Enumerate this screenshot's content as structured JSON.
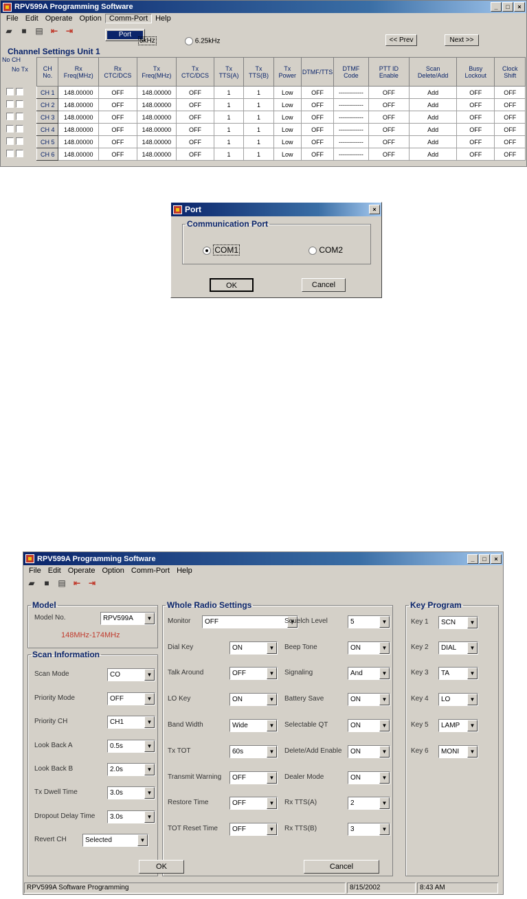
{
  "top_window": {
    "title": "RPV599A Programming Software",
    "menu": [
      "File",
      "Edit",
      "Operate",
      "Option",
      "Comm-Port",
      "Help"
    ],
    "menu_popup": "Port",
    "step_partial": "5kHz",
    "step_625": "6.25kHz",
    "prev_label": "<< Prev",
    "next_label": "Next >>",
    "group_title": "Channel Settings Unit 1",
    "nocol_label": "No CH",
    "notx_label": "No Tx",
    "headers": [
      "CH No.",
      "Rx Freq(MHz)",
      "Rx CTC/DCS",
      "Tx Freq(MHz)",
      "Tx CTC/DCS",
      "Tx TTS(A)",
      "Tx TTS(B)",
      "Tx Power",
      "DTMF/TTS",
      "DTMF Code",
      "PTT ID Enable",
      "Scan Delete/Add",
      "Busy Lockout",
      "Clock Shift"
    ],
    "rows": [
      [
        "CH 1",
        "148.00000",
        "OFF",
        "148.00000",
        "OFF",
        "1",
        "1",
        "Low",
        "OFF",
        "------------",
        "OFF",
        "Add",
        "OFF",
        "OFF"
      ],
      [
        "CH 2",
        "148.00000",
        "OFF",
        "148.00000",
        "OFF",
        "1",
        "1",
        "Low",
        "OFF",
        "------------",
        "OFF",
        "Add",
        "OFF",
        "OFF"
      ],
      [
        "CH 3",
        "148.00000",
        "OFF",
        "148.00000",
        "OFF",
        "1",
        "1",
        "Low",
        "OFF",
        "------------",
        "OFF",
        "Add",
        "OFF",
        "OFF"
      ],
      [
        "CH 4",
        "148.00000",
        "OFF",
        "148.00000",
        "OFF",
        "1",
        "1",
        "Low",
        "OFF",
        "------------",
        "OFF",
        "Add",
        "OFF",
        "OFF"
      ],
      [
        "CH 5",
        "148.00000",
        "OFF",
        "148.00000",
        "OFF",
        "1",
        "1",
        "Low",
        "OFF",
        "------------",
        "OFF",
        "Add",
        "OFF",
        "OFF"
      ],
      [
        "CH 6",
        "148.00000",
        "OFF",
        "148.00000",
        "OFF",
        "1",
        "1",
        "Low",
        "OFF",
        "------------",
        "OFF",
        "Add",
        "OFF",
        "OFF"
      ]
    ]
  },
  "port_dialog": {
    "title": "Port",
    "group": "Communication Port",
    "com1": "COM1",
    "com2": "COM2",
    "ok": "OK",
    "cancel": "Cancel"
  },
  "main_window": {
    "title": "RPV599A Programming Software",
    "menu": [
      "File",
      "Edit",
      "Operate",
      "Option",
      "Comm-Port",
      "Help"
    ],
    "model": {
      "legend": "Model",
      "label": "Model No.",
      "value": "RPV599A",
      "range": "148MHz-174MHz"
    },
    "scan": {
      "legend": "Scan Information",
      "fields": [
        {
          "label": "Scan Mode",
          "value": "CO"
        },
        {
          "label": "Priority Mode",
          "value": "OFF"
        },
        {
          "label": "Priority CH",
          "value": "CH1"
        },
        {
          "label": "Look Back A",
          "value": "0.5s"
        },
        {
          "label": "Look Back B",
          "value": "2.0s"
        },
        {
          "label": "Tx Dwell Time",
          "value": "3.0s"
        },
        {
          "label": "Dropout Delay Time",
          "value": "3.0s"
        },
        {
          "label": "Revert CH",
          "value": "Selected"
        }
      ]
    },
    "whole": {
      "legend": "Whole Radio Settings",
      "left": [
        {
          "label": "Monitor",
          "value": "OFF"
        },
        {
          "label": "Dial Key",
          "value": "ON"
        },
        {
          "label": "Talk Around",
          "value": "OFF"
        },
        {
          "label": "LO Key",
          "value": "ON"
        },
        {
          "label": "Band Width",
          "value": "Wide"
        },
        {
          "label": "Tx TOT",
          "value": "60s"
        },
        {
          "label": "Transmit Warning",
          "value": "OFF"
        },
        {
          "label": "Restore Time",
          "value": "OFF"
        },
        {
          "label": "TOT Reset Time",
          "value": "OFF"
        }
      ],
      "right": [
        {
          "label": "Squelch Level",
          "value": "5"
        },
        {
          "label": "Beep Tone",
          "value": "ON"
        },
        {
          "label": "Signaling",
          "value": "And"
        },
        {
          "label": "Battery Save",
          "value": "ON"
        },
        {
          "label": "Selectable QT",
          "value": "ON"
        },
        {
          "label": "Delete/Add Enable",
          "value": "ON"
        },
        {
          "label": "Dealer Mode",
          "value": "ON"
        },
        {
          "label": "Rx TTS(A)",
          "value": "2"
        },
        {
          "label": "Rx TTS(B)",
          "value": "3"
        }
      ]
    },
    "keys": {
      "legend": "Key Program",
      "items": [
        {
          "label": "Key 1",
          "value": "SCN"
        },
        {
          "label": "Key 2",
          "value": "DIAL"
        },
        {
          "label": "Key 3",
          "value": "TA"
        },
        {
          "label": "Key 4",
          "value": "LO"
        },
        {
          "label": "Key 5",
          "value": "LAMP"
        },
        {
          "label": "Key 6",
          "value": "MONI"
        }
      ]
    },
    "ok": "OK",
    "cancel": "Cancel",
    "status": {
      "text": "RPV599A Software Programming",
      "date": "8/15/2002",
      "time": "8:43 AM"
    }
  }
}
